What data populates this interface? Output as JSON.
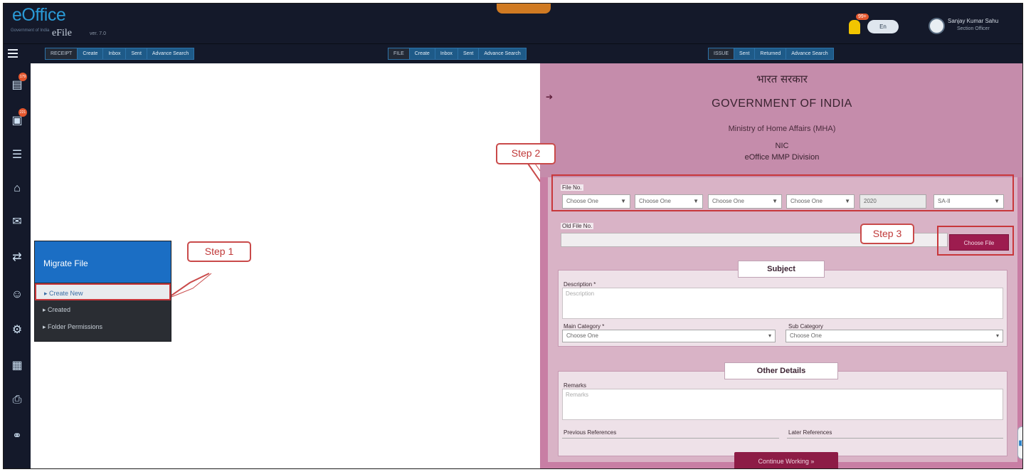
{
  "header": {
    "logo": "eOffice",
    "logo_tagline": "Government of India",
    "app_title": "eFile",
    "app_version": "ver. 7.0",
    "notification_count": "99+",
    "toggle_label": "En",
    "user_name": "Sanjay Kumar Sahu",
    "user_designation": "Section Officer"
  },
  "nav": {
    "groups": [
      {
        "head": "RECEIPT",
        "items": [
          "Create",
          "Inbox",
          "Sent",
          "Advance Search"
        ]
      },
      {
        "head": "FILE",
        "items": [
          "Create",
          "Inbox",
          "Sent",
          "Advance Search"
        ]
      },
      {
        "head": "ISSUE",
        "items": [
          "Sent",
          "Returned",
          "Advance Search"
        ]
      }
    ]
  },
  "sidebar": {
    "badges": [
      "179",
      "221"
    ]
  },
  "migrate_menu": {
    "title": "Migrate File",
    "items": [
      "Create New",
      "Created",
      "Folder Permissions"
    ]
  },
  "steps": {
    "step1": "Step 1",
    "step2": "Step 2",
    "step3": "Step 3"
  },
  "form": {
    "gov_hindi": "भारत सरकार",
    "gov_english": "GOVERNMENT OF INDIA",
    "ministry": "Ministry of Home Affairs (MHA)",
    "org": "NIC",
    "division": "eOffice MMP Division",
    "file_no_label": "File No.",
    "file_no_selects": [
      "Choose One",
      "Choose One",
      "Choose One",
      "Choose One"
    ],
    "year": "2020",
    "last_select": "SA-II",
    "old_file_label": "Old File No.",
    "choose_file": "Choose File",
    "subject_title": "Subject",
    "description_label": "Description *",
    "description_placeholder": "Description",
    "main_category_label": "Main Category *",
    "main_category_value": "Choose One",
    "sub_category_label": "Sub Category",
    "sub_category_value": "Choose One",
    "other_details_title": "Other Details",
    "remarks_label": "Remarks",
    "remarks_placeholder": "Remarks",
    "previous_references_label": "Previous References",
    "later_references_label": "Later References",
    "continue_button": "Continue Working »"
  },
  "colors": {
    "header_bg": "#14192a",
    "nav_blue": "#1e5a88",
    "panel_pink": "#c87ea4",
    "button_maroon": "#9d1c4f",
    "callout_red": "#c8373b",
    "menu_blue": "#1b6ec4"
  },
  "icons": [
    "menu-icon",
    "receipt-icon",
    "file-icon",
    "list-icon",
    "home-icon",
    "dispatch-icon",
    "migrate-icon",
    "user-icon",
    "settings-icon",
    "book-icon",
    "print-icon",
    "share-icon",
    "bell-icon",
    "avatar-icon",
    "chat-icon"
  ]
}
